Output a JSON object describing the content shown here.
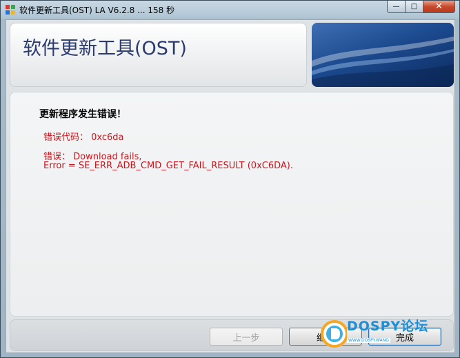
{
  "window": {
    "title": "软件更新工具(OST) LA V6.2.8 ... 158 秒",
    "min_glyph": "—",
    "max_glyph": "□",
    "close_glyph": "✕"
  },
  "header": {
    "title": "软件更新工具(OST)"
  },
  "content": {
    "heading": "更新程序发生错误！",
    "error_code_line": "错误代码：  0xc6da",
    "error_line_1": "错误：  Download fails,",
    "error_line_2": "Error = SE_ERR_ADB_CMD_GET_FAIL_RESULT (0xC6DA)."
  },
  "footer": {
    "back_label": "上一步",
    "continue_label": "继续",
    "finish_label": "完成"
  },
  "watermark": {
    "brand": "DOSPY论坛",
    "sub": "WWW.DOSPY.WANG"
  },
  "colors": {
    "error": "#c8161d",
    "header_title": "#2a3a6f",
    "accent": "#1c8fd6"
  }
}
